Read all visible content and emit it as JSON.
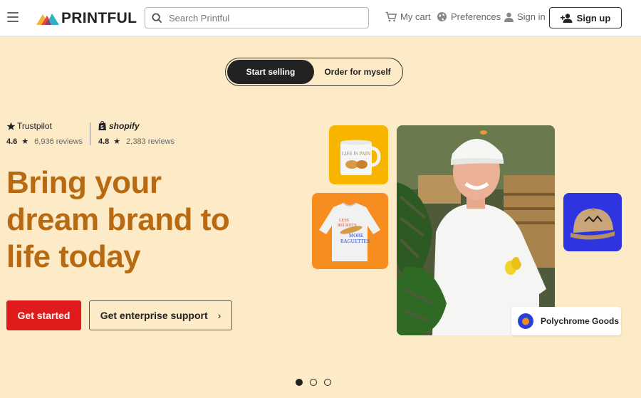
{
  "header": {
    "logo_text": "PRINTFUL",
    "search": {
      "placeholder": "Search Printful",
      "value": ""
    },
    "cart_label": "My cart",
    "preferences_label": "Preferences",
    "signin_label": "Sign in",
    "signup_label": "Sign up"
  },
  "toggle": {
    "options": [
      {
        "label": "Start selling",
        "active": true
      },
      {
        "label": "Order for myself",
        "active": false
      }
    ]
  },
  "ratings": [
    {
      "brand": "Trustpilot",
      "score": "4.6",
      "reviews": "6,936 reviews"
    },
    {
      "brand": "shopify",
      "score": "4.8",
      "reviews": "2,383 reviews"
    }
  ],
  "hero": {
    "headline_lines": [
      "Bring your",
      "dream brand to",
      "life today"
    ],
    "primary_cta": "Get started",
    "secondary_cta": "Get enterprise support",
    "brand_card_label": "Polychrome Goods"
  },
  "product_texts": {
    "mug": "LIFE IS PAIN",
    "sweat_line1": "LESS",
    "sweat_line2": "REGRETS",
    "sweat_line3": "MORE",
    "sweat_line4": "BAGUETTES"
  },
  "carousel": {
    "dot_count": 3,
    "active_index": 0
  },
  "colors": {
    "background": "#fdebc8",
    "headline": "#b76a12",
    "primary_button": "#e01b1b",
    "mug_tile": "#f7b500",
    "sweat_tile": "#f78c1f",
    "hat_tile": "#2d34e0"
  }
}
